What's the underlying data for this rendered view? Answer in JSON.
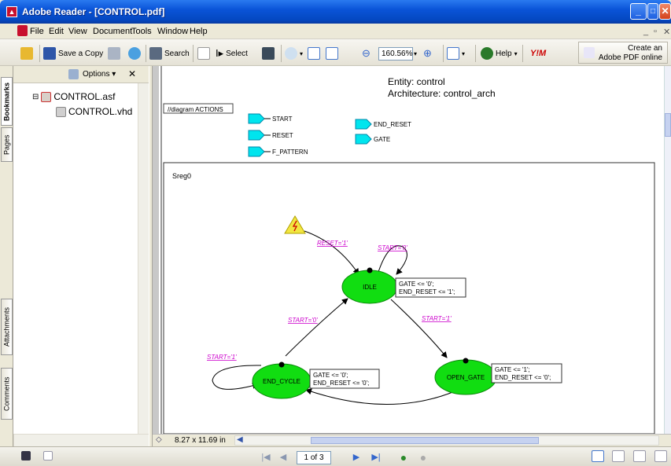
{
  "window": {
    "title": "Adobe Reader - [CONTROL.pdf]"
  },
  "menu": [
    "File",
    "Edit",
    "View",
    "Document",
    "Tools",
    "Window",
    "Help"
  ],
  "toolbar": {
    "save_copy": "Save a Copy",
    "search": "Search",
    "select": "Select",
    "zoom_value": "160.56%",
    "help": "Help",
    "ym": "Y!M",
    "create_pdf_line1": "Create an",
    "create_pdf_line2": "Adobe PDF online"
  },
  "nav_pane": {
    "options_label": "Options",
    "tabs": [
      "Bookmarks",
      "Pages",
      "Attachments",
      "Comments"
    ],
    "tree": [
      {
        "label": "CONTROL.asf",
        "expand": "⊟"
      },
      {
        "label": "CONTROL.vhd"
      }
    ]
  },
  "document": {
    "entity": "Entity: control",
    "architecture": "Architecture: control_arch",
    "actions_label": "//diagram ACTIONS",
    "inputs": [
      "START",
      "RESET",
      "F_PATTERN"
    ],
    "outputs": [
      "END_RESET",
      "GATE"
    ],
    "sreg_label": "Sreg0",
    "states": {
      "idle": "IDLE",
      "open_gate": "OPEN_GATE",
      "end_cycle": "END_CYCLE"
    },
    "transitions": {
      "reset": "RESET='1'",
      "idle_loop": "START='0'",
      "idle_to_open": "START='1'",
      "end_to_idle": "START='0'",
      "end_loop": "START='1'"
    },
    "actions": {
      "idle_1": "GATE <= '0';",
      "idle_2": "END_RESET <= '1';",
      "open_1": "GATE <= '1';",
      "open_2": "END_RESET <= '0';",
      "end_1": "GATE <= '0';",
      "end_2": "END_RESET <= '0';"
    }
  },
  "statusbar": {
    "page_size": "8.27 x 11.69 in",
    "page_of": "1 of 3"
  },
  "colors": {
    "state_fill": "#11dd11",
    "transition_label": "#cc00cc",
    "io_fill": "#00e5ee",
    "titlebar": "#0a54d8"
  }
}
